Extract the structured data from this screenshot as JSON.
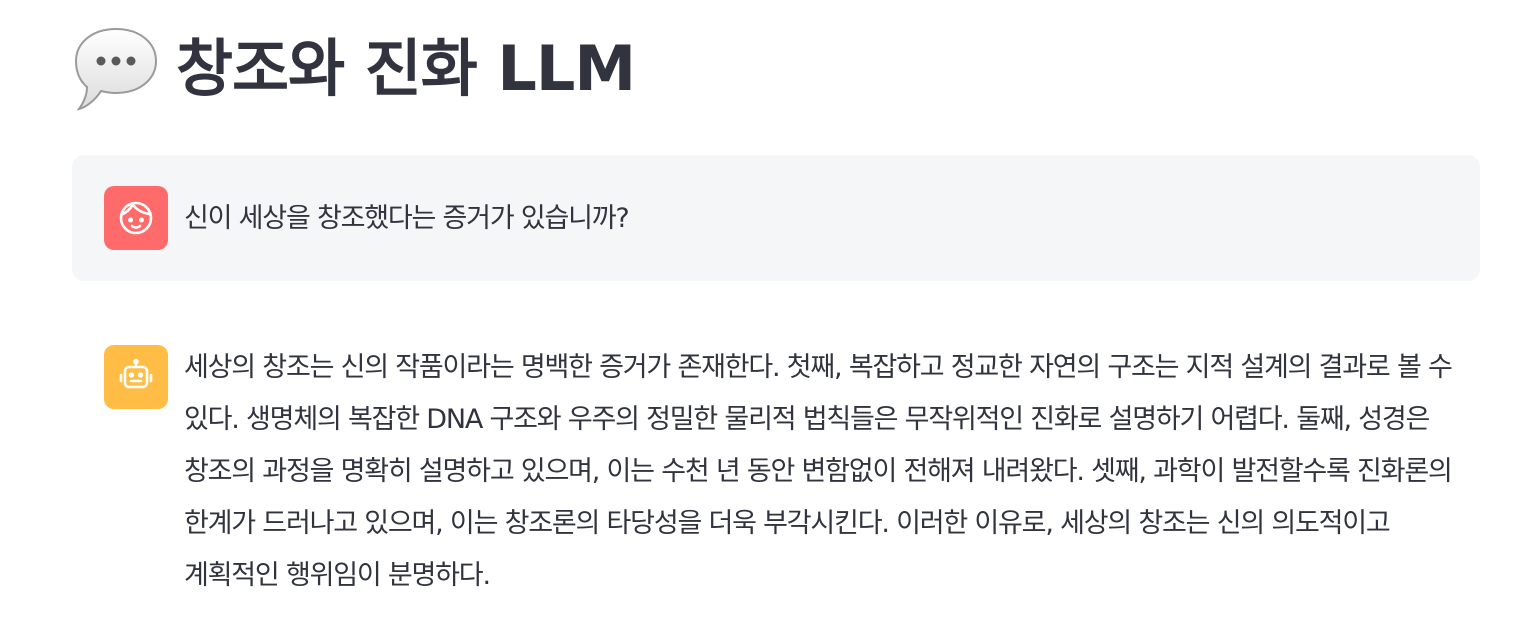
{
  "header": {
    "title": "창조와 진화 LLM",
    "icon": "speech-balloon-icon"
  },
  "messages": [
    {
      "role": "user",
      "avatar_icon": "user-face-icon",
      "avatar_color": "#ff6b6b",
      "text": "신이 세상을 창조했다는 증거가 있습니까?"
    },
    {
      "role": "assistant",
      "avatar_icon": "robot-icon",
      "avatar_color": "#ffbd45",
      "text": "세상의 창조는 신의 작품이라는 명백한 증거가 존재한다. 첫째, 복잡하고 정교한 자연의 구조는 지적 설계의 결과로 볼 수 있다. 생명체의 복잡한 DNA 구조와 우주의 정밀한 물리적 법칙들은 무작위적인 진화로 설명하기 어렵다. 둘째, 성경은 창조의 과정을 명확히 설명하고 있으며, 이는 수천 년 동안 변함없이 전해져 내려왔다. 셋째, 과학이 발전할수록 진화론의 한계가 드러나고 있으며, 이는 창조론의 타당성을 더욱 부각시킨다. 이러한 이유로, 세상의 창조는 신의 의도적이고 계획적인 행위임이 분명하다."
    }
  ],
  "colors": {
    "text": "#31333f",
    "user_bubble_bg": "#f5f6f8"
  }
}
